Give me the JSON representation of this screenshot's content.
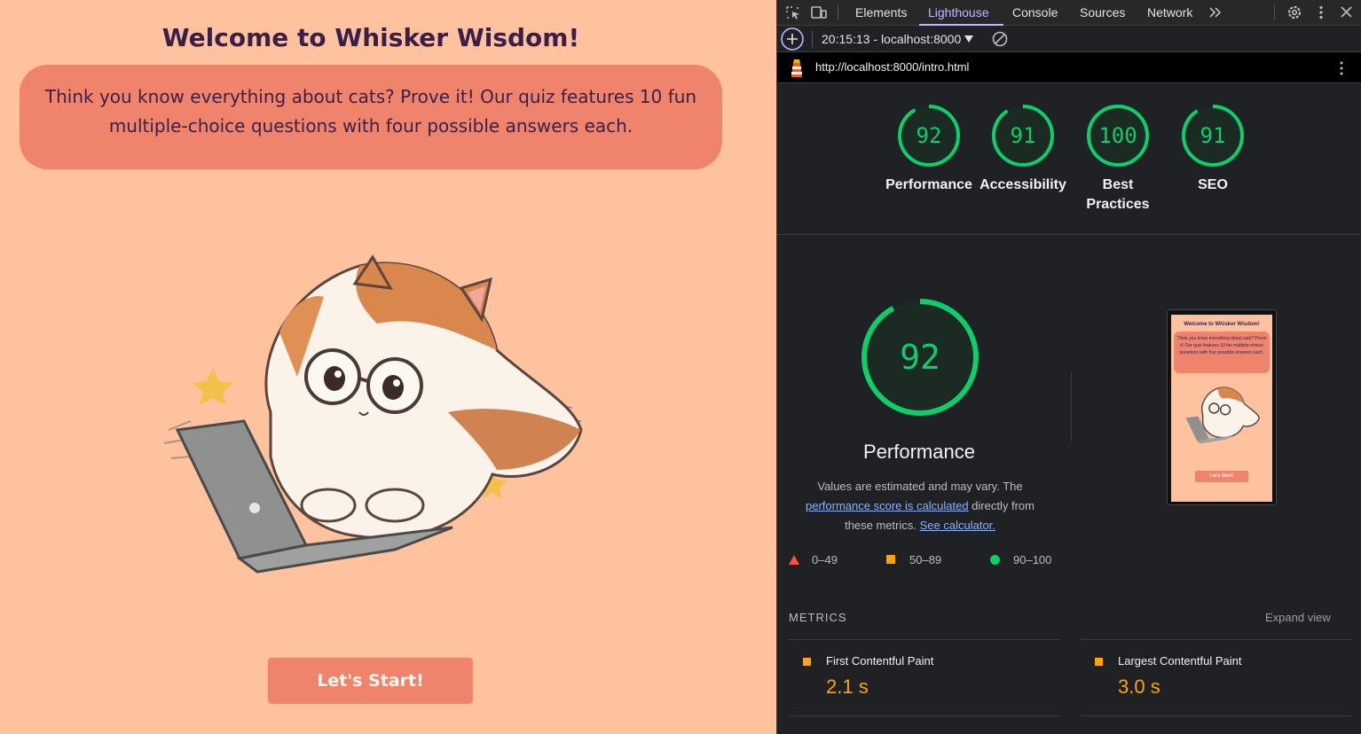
{
  "page": {
    "title": "Welcome to Whisker Wisdom!",
    "intro": "Think you know everything about cats? Prove it! Our quiz features 10 fun multiple-choice questions with four possible answers each.",
    "start_button": "Let's Start!"
  },
  "devtools": {
    "tabs": [
      {
        "label": "Elements",
        "active": false
      },
      {
        "label": "Lighthouse",
        "active": true
      },
      {
        "label": "Console",
        "active": false
      },
      {
        "label": "Sources",
        "active": false
      },
      {
        "label": "Network",
        "active": false
      }
    ],
    "more_tabs_icon": "chevron-double-right-icon",
    "report_selector": "20:15:13 - localhost:8000",
    "url": "http://localhost:8000/intro.html",
    "scores": [
      {
        "label": "Performance",
        "value": "92"
      },
      {
        "label": "Accessibility",
        "value": "91"
      },
      {
        "label": "Best Practices",
        "value": "100"
      },
      {
        "label": "SEO",
        "value": "91"
      }
    ],
    "performance": {
      "score": "92",
      "title": "Performance",
      "desc_prefix": "Values are estimated and may vary. The",
      "desc_link": "performance score is calculated",
      "desc_middle": "directly from these metrics.",
      "calc_link": "See calculator."
    },
    "legend": [
      {
        "label": "0–49",
        "color": "#ff4e42"
      },
      {
        "label": "50–89",
        "color": "#ffa400"
      },
      {
        "label": "90–100",
        "color": "#0cce6b"
      }
    ],
    "metrics_header": "METRICS",
    "expand_view": "Expand view",
    "metrics": [
      {
        "name": "First Contentful Paint",
        "value": "2.1 s",
        "color": "#ffa400"
      },
      {
        "name": "Largest Contentful Paint",
        "value": "3.0 s",
        "color": "#ffa400"
      }
    ],
    "thumbnail": {
      "title": "Welcome to Whisker Wisdom!",
      "text": "Think you know everything about cats? Prove it! Our quiz features 10 fun multiple-choice questions with four possible answers each.",
      "button": "Let's Start!"
    }
  },
  "colors": {
    "page_bg": "#ffc29e",
    "accent": "#f0836b",
    "title_text": "#3a1f4a",
    "pass_green": "#0cce6b",
    "average_orange": "#ffa400",
    "fail_red": "#ff4e42",
    "link_blue": "#8ab4f8"
  }
}
